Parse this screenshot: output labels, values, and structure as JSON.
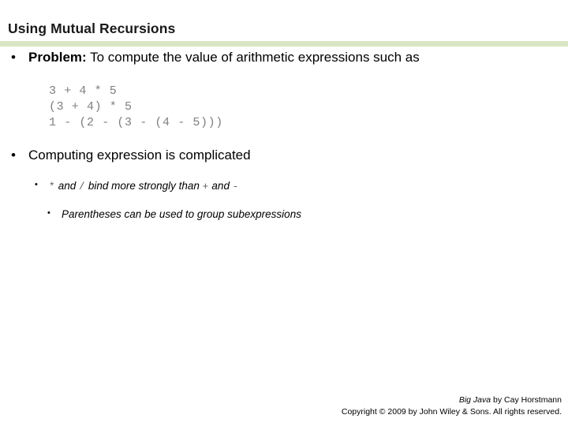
{
  "slide": {
    "title": "Using Mutual Recursions",
    "accent_color": "#d9e6c3",
    "bullets": {
      "problem_marker": "•",
      "problem_label": "Problem:",
      "problem_text": " To compute the value of arithmetic expressions such as",
      "code_lines": [
        "3 + 4 * 5",
        "(3 + 4) * 5",
        "1 - (2 - (3 - (4 - 5)))"
      ],
      "computing_marker": "•",
      "computing_text": "Computing expression is complicated",
      "precedence_marker": "•",
      "precedence_pre": "",
      "precedence_op1": "*",
      "precedence_mid1": " and ",
      "precedence_op2": "/",
      "precedence_mid2": " bind more strongly than ",
      "precedence_op3": "+",
      "precedence_mid3": " and ",
      "precedence_op4": "-",
      "parentheses_marker": "•",
      "parentheses_text": "Parentheses can be used to group subexpressions"
    },
    "footer": {
      "book": "Big Java",
      "author": " by Cay Horstmann",
      "copyright": "Copyright © 2009 by John Wiley & Sons.  All rights reserved."
    }
  }
}
